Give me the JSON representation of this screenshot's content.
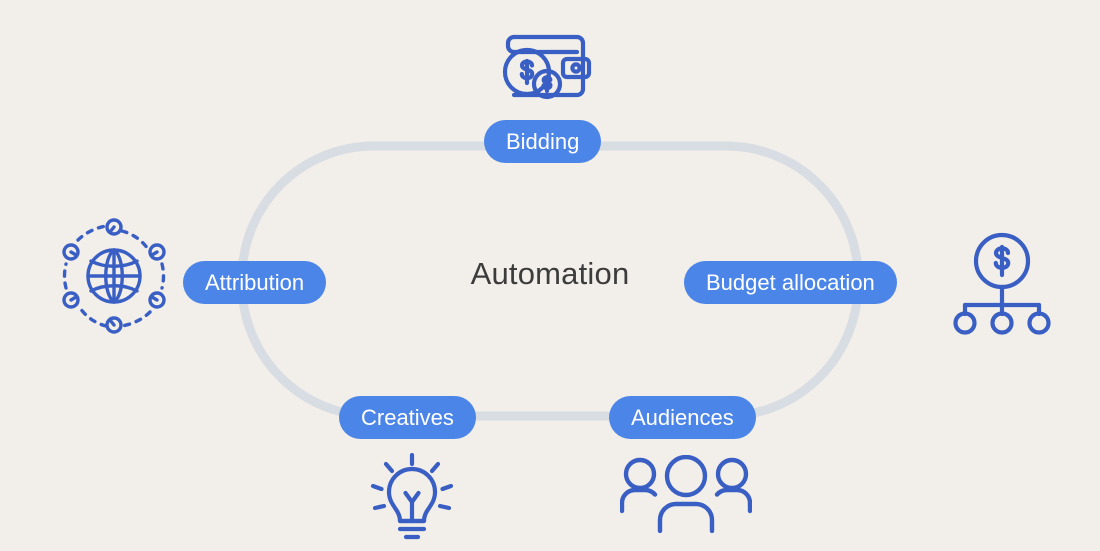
{
  "diagram": {
    "center_label": "Automation",
    "background_color": "#f2eee9",
    "pill_color": "#4c85e8",
    "pill_text_color": "#ffffff",
    "ring_color": "#d8dde3",
    "icon_color": "#3a5fc4",
    "center_text_color": "#3c3c3c"
  },
  "nodes": [
    {
      "id": "bidding",
      "label": "Bidding",
      "icon_name": "wallet-with-coins-icon",
      "position": "top"
    },
    {
      "id": "budget-allocation",
      "label": "Budget allocation",
      "icon_name": "dollar-hierarchy-icon",
      "position": "right"
    },
    {
      "id": "audiences",
      "label": "Audiences",
      "icon_name": "three-people-icon",
      "position": "bottom-right"
    },
    {
      "id": "creatives",
      "label": "Creatives",
      "icon_name": "lightbulb-icon",
      "position": "bottom-left"
    },
    {
      "id": "attribution",
      "label": "Attribution",
      "icon_name": "globe-network-icon",
      "position": "left"
    }
  ]
}
